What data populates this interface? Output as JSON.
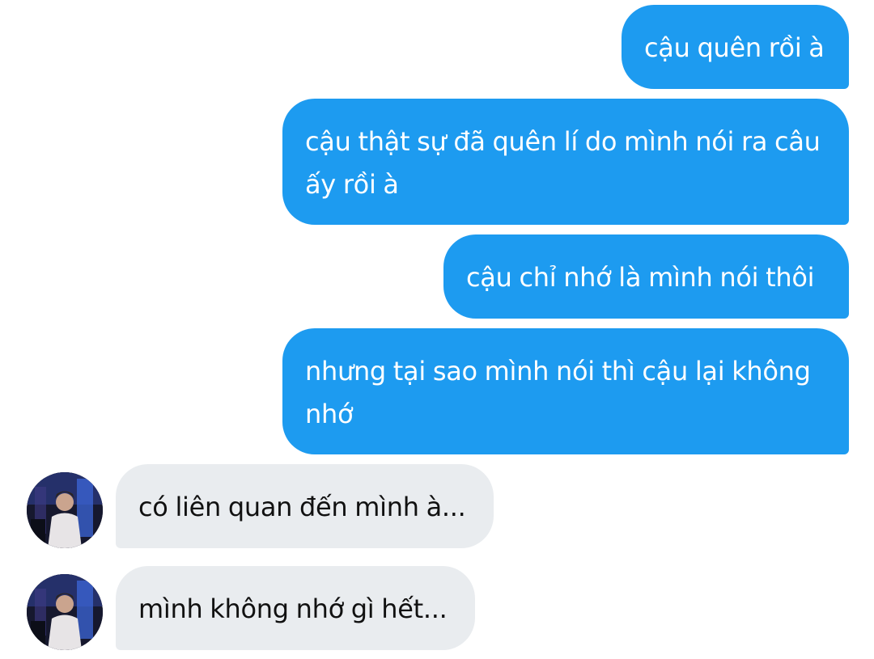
{
  "conversation": {
    "outgoing": [
      {
        "text": "cậu quên rồi à"
      },
      {
        "text": "cậu thật sự đã quên lí do mình nói ra câu ấy rồi à"
      },
      {
        "text": "cậu chỉ nhớ là mình nói thôi"
      },
      {
        "text": "nhưng tại sao mình nói thì cậu lại không nhớ"
      }
    ],
    "incoming": [
      {
        "text": "có liên quan đến mình à..."
      },
      {
        "text": "mình không nhớ gì hết..."
      }
    ]
  },
  "colors": {
    "outgoing_bubble": "#1d9bf0",
    "incoming_bubble": "#e9ecef",
    "outgoing_text": "#ffffff",
    "incoming_text": "#111111"
  },
  "icons": {
    "avatar": "user-avatar-photo"
  }
}
